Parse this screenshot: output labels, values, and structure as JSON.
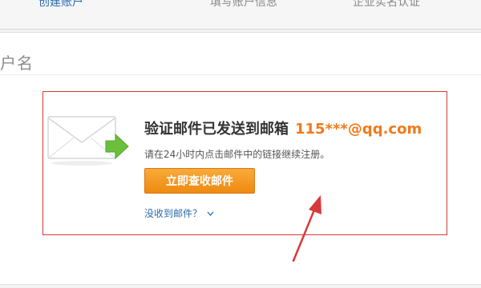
{
  "steps": [
    {
      "label": "创建账户",
      "active": true
    },
    {
      "label": "填写账户信息",
      "active": false
    },
    {
      "label": "企业实名认证",
      "active": false
    }
  ],
  "section": {
    "title": "户名"
  },
  "notice": {
    "headline": "验证邮件已发送到邮箱",
    "email": "115***@qq.com",
    "instruction": "请在24小时内点击邮件中的链接继续注册。",
    "button_label": "立即查收邮件",
    "help_link": "没收到邮件？"
  },
  "icons": {
    "envelope": "envelope-with-green-arrow-icon",
    "chevron": "chevron-down-icon",
    "annotation": "red-annotation-arrow"
  },
  "colors": {
    "accent_orange": "#f07a1a",
    "button_orange": "#ee8a10",
    "link_blue": "#2a6cb0",
    "annotation_red": "#d9383a"
  }
}
